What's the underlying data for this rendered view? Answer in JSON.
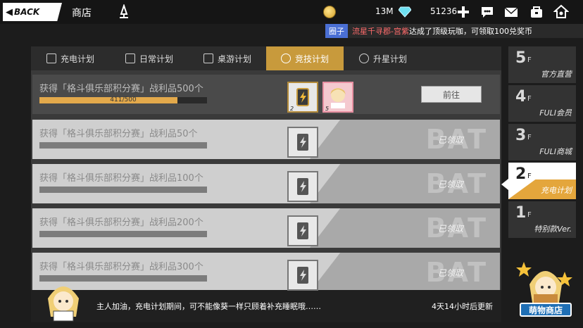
{
  "topbar": {
    "back_label": "BACK",
    "title": "商店",
    "coins": "13M",
    "gems": "51236",
    "icons": [
      "pin-icon",
      "coin-icon",
      "gem-icon",
      "plus-icon",
      "chat-icon",
      "mail-icon",
      "bag-icon",
      "home-icon"
    ]
  },
  "marquee": {
    "tag": "圈子",
    "user": "流星千寻郡-宫紫",
    "message": "达成了顶级玩咖，可领取100兑奖币"
  },
  "tabs": [
    {
      "label": "充电计划",
      "icon": "battery-icon"
    },
    {
      "label": "日常计划",
      "icon": "book-icon"
    },
    {
      "label": "桌游计划",
      "icon": "board-icon"
    },
    {
      "label": "竞技计划",
      "icon": "fist-icon"
    },
    {
      "label": "升星计划",
      "icon": "star-icon"
    }
  ],
  "tasks": [
    {
      "title": "获得「格斗俱乐部积分赛」战利品500个",
      "progress_text": "411/500",
      "progress": 0.822,
      "reward1_count": "2",
      "reward2_count": "5",
      "button": "前往"
    },
    {
      "title": "获得「格斗俱乐部积分赛」战利品50个",
      "status": "已领取"
    },
    {
      "title": "获得「格斗俱乐部积分赛」战利品100个",
      "status": "已领取"
    },
    {
      "title": "获得「格斗俱乐部积分赛」战利品200个",
      "status": "已领取"
    },
    {
      "title": "获得「格斗俱乐部积分赛」战利品300个",
      "status": "已领取"
    }
  ],
  "watermark": "BAT",
  "footer": {
    "hint": "主人加油，充电计划期间，可不能像葵一样只顾着补充睡眠哦……",
    "timer": "4天14小时后更新"
  },
  "floors": [
    {
      "num": "5",
      "suffix": "F",
      "label": "官方直营"
    },
    {
      "num": "4",
      "suffix": "F",
      "label": "FULI会员"
    },
    {
      "num": "3",
      "suffix": "F",
      "label": "FULI商城"
    },
    {
      "num": "2",
      "suffix": "F",
      "label": "充电计划"
    },
    {
      "num": "1",
      "suffix": "F",
      "label": "特别款Ver."
    }
  ],
  "shop_button": "萌物商店",
  "colors": {
    "accent": "#c89a3c",
    "progress": "#e3a94b",
    "floor_active": "#e4a63c",
    "marquee_user": "#ff6b6b"
  }
}
